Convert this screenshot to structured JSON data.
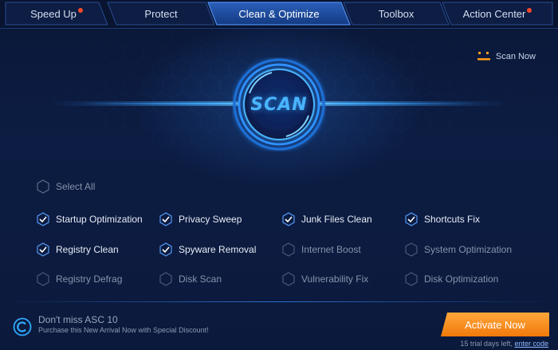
{
  "tabs": [
    {
      "label": "Speed Up",
      "badge": true,
      "active": false
    },
    {
      "label": "Protect",
      "badge": false,
      "active": false
    },
    {
      "label": "Clean & Optimize",
      "badge": false,
      "active": true
    },
    {
      "label": "Toolbox",
      "badge": false,
      "active": false
    },
    {
      "label": "Action Center",
      "badge": true,
      "active": false
    }
  ],
  "scan": {
    "button_label": "SCAN",
    "scan_now_label": "Scan Now"
  },
  "select_all": {
    "label": "Select All",
    "checked": false
  },
  "options": [
    {
      "label": "Startup Optimization",
      "checked": true
    },
    {
      "label": "Privacy Sweep",
      "checked": true
    },
    {
      "label": "Junk Files Clean",
      "checked": true
    },
    {
      "label": "Shortcuts Fix",
      "checked": true
    },
    {
      "label": "Registry Clean",
      "checked": true
    },
    {
      "label": "Spyware Removal",
      "checked": true
    },
    {
      "label": "Internet Boost",
      "checked": false
    },
    {
      "label": "System Optimization",
      "checked": false
    },
    {
      "label": "Registry Defrag",
      "checked": false
    },
    {
      "label": "Disk Scan",
      "checked": false
    },
    {
      "label": "Vulnerability Fix",
      "checked": false
    },
    {
      "label": "Disk Optimization",
      "checked": false
    }
  ],
  "footer": {
    "promo_title": "Don't miss ASC 10",
    "promo_subtitle": "Purchase this New Arrival Now with Special Discount!",
    "activate_label": "Activate Now",
    "trial_text": "15 trial days left,",
    "enter_code_label": "enter code"
  },
  "colors": {
    "accent_blue": "#2f8fff",
    "activate_orange": "#ff8c1a",
    "badge_red": "#ff4a2a",
    "scan_now_icon": "#ff9a1a"
  },
  "icons": {
    "scan_now": "face-icon",
    "promo": "asc-logo-icon",
    "checkbox_checked": "hex-check-icon",
    "checkbox_unchecked": "hex-empty-icon"
  }
}
